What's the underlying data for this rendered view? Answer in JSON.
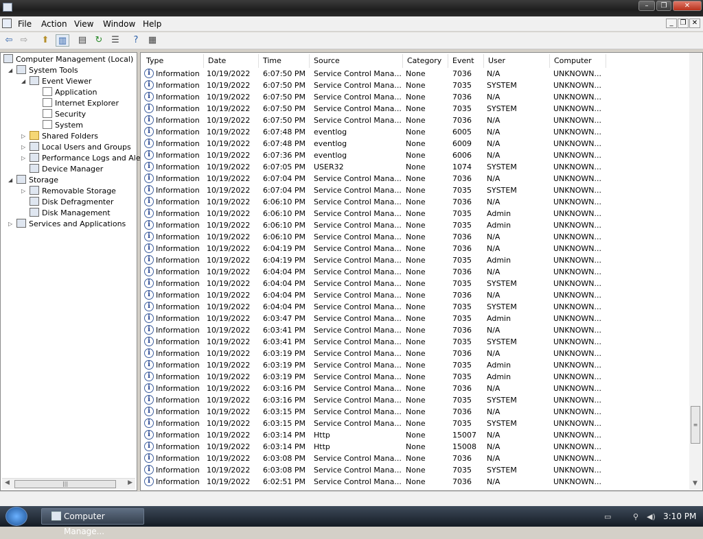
{
  "menubar": {
    "items": [
      "File",
      "Action",
      "View",
      "Window",
      "Help"
    ]
  },
  "tree": [
    {
      "label": "Computer Management (Local)",
      "level": 0,
      "icon": "computer-icon"
    },
    {
      "label": "System Tools",
      "level": 1,
      "icon": "tools-icon"
    },
    {
      "label": "Event Viewer",
      "level": 2,
      "icon": "event-viewer-icon"
    },
    {
      "label": "Application",
      "level": 3,
      "icon": "log-icon"
    },
    {
      "label": "Internet Explorer",
      "level": 3,
      "icon": "log-icon"
    },
    {
      "label": "Security",
      "level": 3,
      "icon": "log-icon"
    },
    {
      "label": "System",
      "level": 3,
      "icon": "log-icon"
    },
    {
      "label": "Shared Folders",
      "level": 2,
      "icon": "folder-icon"
    },
    {
      "label": "Local Users and Groups",
      "level": 2,
      "icon": "users-icon"
    },
    {
      "label": "Performance Logs and Ale",
      "level": 2,
      "icon": "performance-icon"
    },
    {
      "label": "Device Manager",
      "level": 2,
      "icon": "device-icon"
    },
    {
      "label": "Storage",
      "level": 1,
      "icon": "storage-icon"
    },
    {
      "label": "Removable Storage",
      "level": 2,
      "icon": "removable-icon"
    },
    {
      "label": "Disk Defragmenter",
      "level": 2,
      "icon": "defrag-icon"
    },
    {
      "label": "Disk Management",
      "level": 2,
      "icon": "disk-icon"
    },
    {
      "label": "Services and Applications",
      "level": 1,
      "icon": "services-icon"
    }
  ],
  "columns": [
    "Type",
    "Date",
    "Time",
    "Source",
    "Category",
    "Event",
    "User",
    "Computer"
  ],
  "rows": [
    [
      "Information",
      "10/19/2022",
      "6:07:50 PM",
      "Service Control Mana...",
      "None",
      "7036",
      "N/A",
      "UNKNOWN..."
    ],
    [
      "Information",
      "10/19/2022",
      "6:07:50 PM",
      "Service Control Mana...",
      "None",
      "7035",
      "SYSTEM",
      "UNKNOWN..."
    ],
    [
      "Information",
      "10/19/2022",
      "6:07:50 PM",
      "Service Control Mana...",
      "None",
      "7036",
      "N/A",
      "UNKNOWN..."
    ],
    [
      "Information",
      "10/19/2022",
      "6:07:50 PM",
      "Service Control Mana...",
      "None",
      "7035",
      "SYSTEM",
      "UNKNOWN..."
    ],
    [
      "Information",
      "10/19/2022",
      "6:07:50 PM",
      "Service Control Mana...",
      "None",
      "7036",
      "N/A",
      "UNKNOWN..."
    ],
    [
      "Information",
      "10/19/2022",
      "6:07:48 PM",
      "eventlog",
      "None",
      "6005",
      "N/A",
      "UNKNOWN..."
    ],
    [
      "Information",
      "10/19/2022",
      "6:07:48 PM",
      "eventlog",
      "None",
      "6009",
      "N/A",
      "UNKNOWN..."
    ],
    [
      "Information",
      "10/19/2022",
      "6:07:36 PM",
      "eventlog",
      "None",
      "6006",
      "N/A",
      "UNKNOWN..."
    ],
    [
      "Information",
      "10/19/2022",
      "6:07:05 PM",
      "USER32",
      "None",
      "1074",
      "SYSTEM",
      "UNKNOWN..."
    ],
    [
      "Information",
      "10/19/2022",
      "6:07:04 PM",
      "Service Control Mana...",
      "None",
      "7036",
      "N/A",
      "UNKNOWN..."
    ],
    [
      "Information",
      "10/19/2022",
      "6:07:04 PM",
      "Service Control Mana...",
      "None",
      "7035",
      "SYSTEM",
      "UNKNOWN..."
    ],
    [
      "Information",
      "10/19/2022",
      "6:06:10 PM",
      "Service Control Mana...",
      "None",
      "7036",
      "N/A",
      "UNKNOWN..."
    ],
    [
      "Information",
      "10/19/2022",
      "6:06:10 PM",
      "Service Control Mana...",
      "None",
      "7035",
      "Admin",
      "UNKNOWN..."
    ],
    [
      "Information",
      "10/19/2022",
      "6:06:10 PM",
      "Service Control Mana...",
      "None",
      "7035",
      "Admin",
      "UNKNOWN..."
    ],
    [
      "Information",
      "10/19/2022",
      "6:06:10 PM",
      "Service Control Mana...",
      "None",
      "7036",
      "N/A",
      "UNKNOWN..."
    ],
    [
      "Information",
      "10/19/2022",
      "6:04:19 PM",
      "Service Control Mana...",
      "None",
      "7036",
      "N/A",
      "UNKNOWN..."
    ],
    [
      "Information",
      "10/19/2022",
      "6:04:19 PM",
      "Service Control Mana...",
      "None",
      "7035",
      "Admin",
      "UNKNOWN..."
    ],
    [
      "Information",
      "10/19/2022",
      "6:04:04 PM",
      "Service Control Mana...",
      "None",
      "7036",
      "N/A",
      "UNKNOWN..."
    ],
    [
      "Information",
      "10/19/2022",
      "6:04:04 PM",
      "Service Control Mana...",
      "None",
      "7035",
      "SYSTEM",
      "UNKNOWN..."
    ],
    [
      "Information",
      "10/19/2022",
      "6:04:04 PM",
      "Service Control Mana...",
      "None",
      "7036",
      "N/A",
      "UNKNOWN..."
    ],
    [
      "Information",
      "10/19/2022",
      "6:04:04 PM",
      "Service Control Mana...",
      "None",
      "7035",
      "SYSTEM",
      "UNKNOWN..."
    ],
    [
      "Information",
      "10/19/2022",
      "6:03:47 PM",
      "Service Control Mana...",
      "None",
      "7035",
      "Admin",
      "UNKNOWN..."
    ],
    [
      "Information",
      "10/19/2022",
      "6:03:41 PM",
      "Service Control Mana...",
      "None",
      "7036",
      "N/A",
      "UNKNOWN..."
    ],
    [
      "Information",
      "10/19/2022",
      "6:03:41 PM",
      "Service Control Mana...",
      "None",
      "7035",
      "SYSTEM",
      "UNKNOWN..."
    ],
    [
      "Information",
      "10/19/2022",
      "6:03:19 PM",
      "Service Control Mana...",
      "None",
      "7036",
      "N/A",
      "UNKNOWN..."
    ],
    [
      "Information",
      "10/19/2022",
      "6:03:19 PM",
      "Service Control Mana...",
      "None",
      "7035",
      "Admin",
      "UNKNOWN..."
    ],
    [
      "Information",
      "10/19/2022",
      "6:03:19 PM",
      "Service Control Mana...",
      "None",
      "7035",
      "Admin",
      "UNKNOWN..."
    ],
    [
      "Information",
      "10/19/2022",
      "6:03:16 PM",
      "Service Control Mana...",
      "None",
      "7036",
      "N/A",
      "UNKNOWN..."
    ],
    [
      "Information",
      "10/19/2022",
      "6:03:16 PM",
      "Service Control Mana...",
      "None",
      "7035",
      "SYSTEM",
      "UNKNOWN..."
    ],
    [
      "Information",
      "10/19/2022",
      "6:03:15 PM",
      "Service Control Mana...",
      "None",
      "7036",
      "N/A",
      "UNKNOWN..."
    ],
    [
      "Information",
      "10/19/2022",
      "6:03:15 PM",
      "Service Control Mana...",
      "None",
      "7035",
      "SYSTEM",
      "UNKNOWN..."
    ],
    [
      "Information",
      "10/19/2022",
      "6:03:14 PM",
      "Http",
      "None",
      "15007",
      "N/A",
      "UNKNOWN..."
    ],
    [
      "Information",
      "10/19/2022",
      "6:03:14 PM",
      "Http",
      "None",
      "15008",
      "N/A",
      "UNKNOWN..."
    ],
    [
      "Information",
      "10/19/2022",
      "6:03:08 PM",
      "Service Control Mana...",
      "None",
      "7036",
      "N/A",
      "UNKNOWN..."
    ],
    [
      "Information",
      "10/19/2022",
      "6:03:08 PM",
      "Service Control Mana...",
      "None",
      "7035",
      "SYSTEM",
      "UNKNOWN..."
    ],
    [
      "Information",
      "10/19/2022",
      "6:02:51 PM",
      "Service Control Mana...",
      "None",
      "7036",
      "N/A",
      "UNKNOWN..."
    ]
  ],
  "taskbar": {
    "task_label": "Computer Manage...",
    "clock": "3:10 PM"
  }
}
